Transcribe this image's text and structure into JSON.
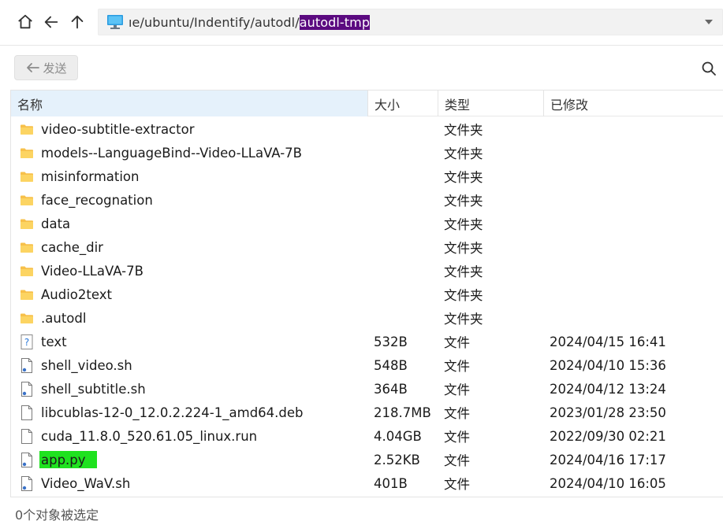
{
  "address_bar": {
    "path_prefix": "ıe/ubuntu/Indentify/autodl/",
    "path_selected": "autodl-tmp",
    "icon": "computer-icon"
  },
  "toolbar": {
    "send_label": "发送",
    "send_icon": "arrow-left-icon",
    "search_icon": "search-icon"
  },
  "columns": {
    "name": "名称",
    "size": "大小",
    "type": "类型",
    "modified": "已修改"
  },
  "files": [
    {
      "name": "video-subtitle-extractor",
      "size": "",
      "type": "文件夹",
      "modified": "",
      "icon": "folder-icon"
    },
    {
      "name": "models--LanguageBind--Video-LLaVA-7B",
      "size": "",
      "type": "文件夹",
      "modified": "",
      "icon": "folder-icon"
    },
    {
      "name": "misinformation",
      "size": "",
      "type": "文件夹",
      "modified": "",
      "icon": "folder-icon"
    },
    {
      "name": "face_recognation",
      "size": "",
      "type": "文件夹",
      "modified": "",
      "icon": "folder-icon"
    },
    {
      "name": "data",
      "size": "",
      "type": "文件夹",
      "modified": "",
      "icon": "folder-icon"
    },
    {
      "name": "cache_dir",
      "size": "",
      "type": "文件夹",
      "modified": "",
      "icon": "folder-icon"
    },
    {
      "name": "Video-LLaVA-7B",
      "size": "",
      "type": "文件夹",
      "modified": "",
      "icon": "folder-icon"
    },
    {
      "name": "Audio2text",
      "size": "",
      "type": "文件夹",
      "modified": "",
      "icon": "folder-icon"
    },
    {
      "name": ".autodl",
      "size": "",
      "type": "文件夹",
      "modified": "",
      "icon": "folder-icon"
    },
    {
      "name": "text",
      "size": "532B",
      "type": "文件",
      "modified": "2024/04/15 16:41",
      "icon": "unknown-file-icon"
    },
    {
      "name": "shell_video.sh",
      "size": "548B",
      "type": "文件",
      "modified": "2024/04/10 15:36",
      "icon": "script-file-icon"
    },
    {
      "name": "shell_subtitle.sh",
      "size": "364B",
      "type": "文件",
      "modified": "2024/04/12 13:24",
      "icon": "script-file-icon"
    },
    {
      "name": "libcublas-12-0_12.0.2.224-1_amd64.deb",
      "size": "218.7MB",
      "type": "文件",
      "modified": "2023/01/28 23:50",
      "icon": "file-icon"
    },
    {
      "name": "cuda_11.8.0_520.61.05_linux.run",
      "size": "4.04GB",
      "type": "文件",
      "modified": "2022/09/30 02:21",
      "icon": "file-icon"
    },
    {
      "name": "app.py",
      "size": "2.52KB",
      "type": "文件",
      "modified": "2024/04/16 17:17",
      "icon": "script-file-icon",
      "highlight": "#1fe21f"
    },
    {
      "name": "Video_WaV.sh",
      "size": "401B",
      "type": "文件",
      "modified": "2024/04/10 16:05",
      "icon": "script-file-icon"
    }
  ],
  "status_bar": {
    "text": "0个对象被选定"
  },
  "colors": {
    "path_selection": "#5b0a80",
    "name_highlight": "#1fe21f",
    "folder": "#f7c04a",
    "header_sorted": "#e5f1fb"
  }
}
